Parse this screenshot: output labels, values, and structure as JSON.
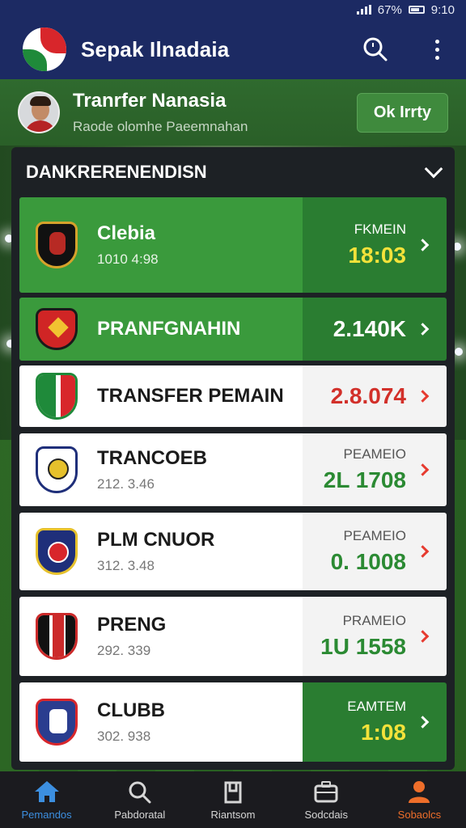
{
  "status": {
    "battery": "67%",
    "time": "9:10"
  },
  "app": {
    "title": "Sepak Ilnadaia"
  },
  "user": {
    "name": "Tranrfer Nanasia",
    "subtitle": "Raode olomhe Paeemnahan",
    "button": "Ok Irrty"
  },
  "panel": {
    "title": "DANKRERENENDISN"
  },
  "rows": [
    {
      "name": "Clebia",
      "sub": "1010 4:98",
      "label": "FKMEIN",
      "value": "18:03",
      "style": "green",
      "value_color": "yellow",
      "crest": "#b72a24"
    },
    {
      "name": "PRANFGNAHIN",
      "sub": "",
      "label": "",
      "value": "2.140K",
      "style": "green",
      "value_color": "white",
      "crest": "#d02525"
    },
    {
      "name": "TRANSFER PEMAIN",
      "sub": "",
      "label": "",
      "value": "2.8.074",
      "style": "white",
      "value_color": "red",
      "crest": "#1f8a3a"
    },
    {
      "name": "TRANCOEB",
      "sub": "212. 3.46",
      "label": "PEAMEIO",
      "value": "2L 1708",
      "style": "white",
      "value_color": "green",
      "crest": "#e6c12c"
    },
    {
      "name": "PLM CNUOR",
      "sub": "312. 3.48",
      "label": "PEAMEIO",
      "value": "0. 1008",
      "style": "white",
      "value_color": "green",
      "crest": "#1f2f7a"
    },
    {
      "name": "PRENG",
      "sub": "292. 339",
      "label": "PRAMEIO",
      "value": "1U 1558",
      "style": "white",
      "value_color": "green",
      "crest": "#cc2a2a"
    },
    {
      "name": "CLUBB",
      "sub": "302. 938",
      "label": "EAMTEM",
      "value": "1:08",
      "style": "mixed",
      "value_color": "yellow",
      "crest": "#2a3d8f"
    }
  ],
  "nav": [
    {
      "label": "Pemandos",
      "icon": "home-icon",
      "color": "#3c8fe0"
    },
    {
      "label": "Pabdoratal",
      "icon": "search-icon",
      "color": "#d6d6d6"
    },
    {
      "label": "Riantsom",
      "icon": "shirt-icon",
      "color": "#d6d6d6"
    },
    {
      "label": "Sodcdais",
      "icon": "briefcase-icon",
      "color": "#d6d6d6"
    },
    {
      "label": "Sobaolcs",
      "icon": "profile-icon",
      "color": "#ee6e2a"
    }
  ]
}
